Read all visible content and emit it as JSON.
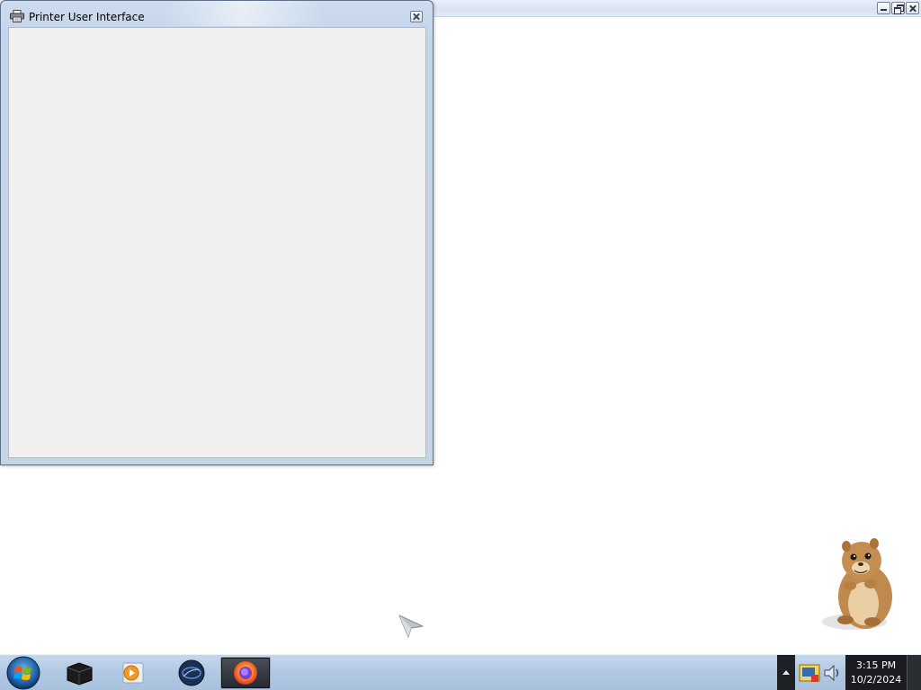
{
  "background_window": {
    "controls": [
      "minimize-icon",
      "maximize-icon",
      "close-icon"
    ]
  },
  "printer_window": {
    "title": "Printer User Interface",
    "icon": "printer-icon",
    "close_icon": "close-icon",
    "client_background": "#f0f0f0"
  },
  "taskbar": {
    "start_icon": "windows-start-icon",
    "buttons": [
      {
        "icon": "black-box-app-icon",
        "active": false
      },
      {
        "icon": "media-player-icon",
        "active": false
      },
      {
        "icon": "globe-app-icon",
        "active": false
      },
      {
        "icon": "firefox-icon",
        "active": true
      }
    ],
    "tray": {
      "icons": [
        "network-icon",
        "volume-icon"
      ],
      "time": "3:15 PM",
      "date": "10/2/2024"
    }
  },
  "desktop": {
    "mascot": "gopher-mascot",
    "cursor": "mouse-cursor"
  }
}
